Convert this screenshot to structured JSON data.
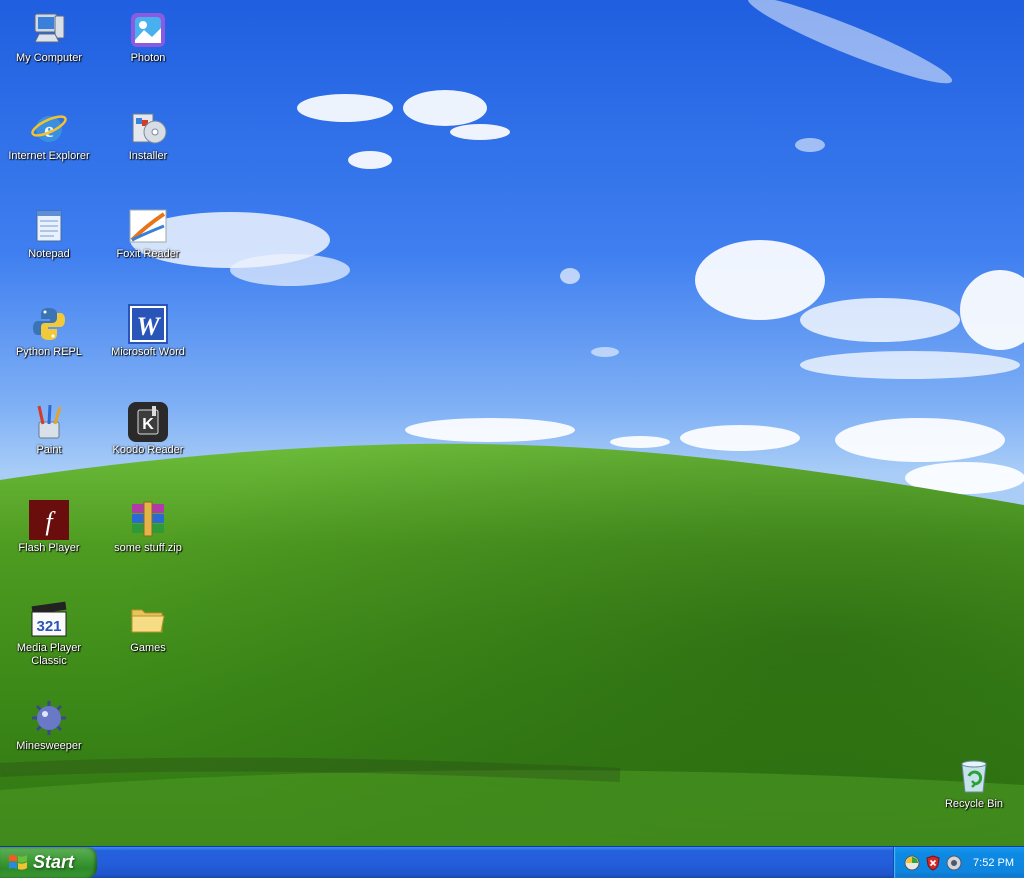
{
  "desktop": {
    "icons": [
      {
        "label": "My Computer",
        "icon": "my-computer-icon"
      },
      {
        "label": "Photon",
        "icon": "photon-icon"
      },
      {
        "label": "Internet Explorer",
        "icon": "internet-explorer-icon"
      },
      {
        "label": "Installer",
        "icon": "installer-icon"
      },
      {
        "label": "Notepad",
        "icon": "notepad-icon"
      },
      {
        "label": "Foxit Reader",
        "icon": "foxit-reader-icon"
      },
      {
        "label": "Python REPL",
        "icon": "python-icon"
      },
      {
        "label": "Microsoft Word",
        "icon": "word-icon"
      },
      {
        "label": "Paint",
        "icon": "paint-icon"
      },
      {
        "label": "Koodo Reader",
        "icon": "koodo-reader-icon"
      },
      {
        "label": "Flash Player",
        "icon": "flash-player-icon"
      },
      {
        "label": "some stuff.zip",
        "icon": "winrar-archive-icon"
      },
      {
        "label": "Media Player Classic",
        "icon": "media-player-classic-icon"
      },
      {
        "label": "Games",
        "icon": "folder-icon"
      },
      {
        "label": "Minesweeper",
        "icon": "minesweeper-icon"
      },
      {
        "label": "Recycle Bin",
        "icon": "recycle-bin-icon"
      }
    ]
  },
  "taskbar": {
    "start_label": "Start",
    "tray": {
      "icons": [
        "network-icon",
        "security-shield-icon",
        "volume-icon"
      ],
      "clock": "7:52 PM"
    }
  },
  "colors": {
    "taskbar_blue": "#245edb",
    "start_green": "#3c9a35",
    "tray_blue": "#0e85de"
  }
}
